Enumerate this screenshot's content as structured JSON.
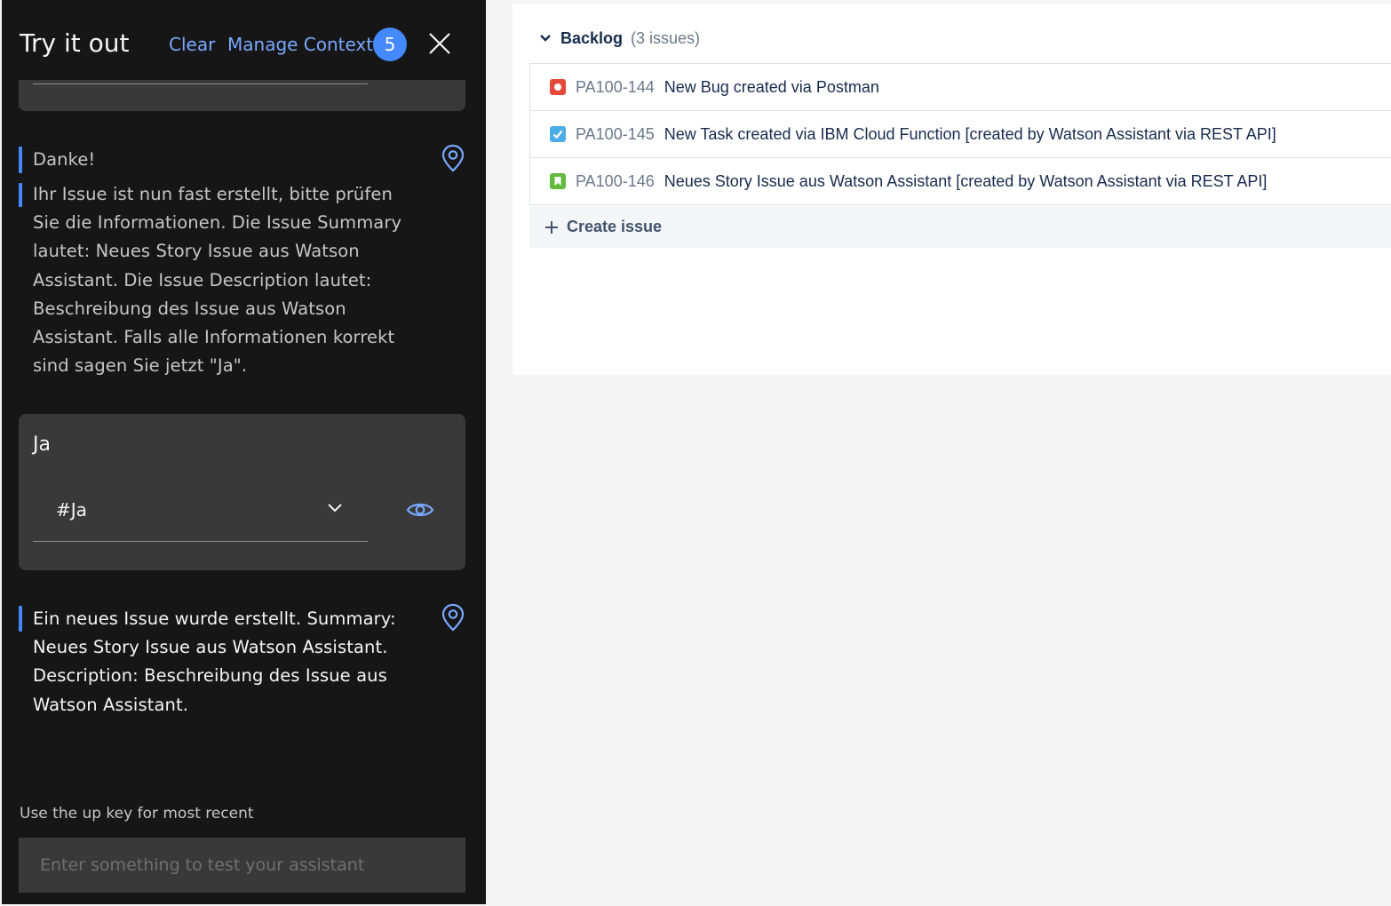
{
  "assistant_panel": {
    "title": "Try it out",
    "clear_label": "Clear",
    "manage_context_label": "Manage Context",
    "context_count": "5",
    "messages": [
      {
        "text": "Danke!"
      },
      {
        "lines": [
          "Ihr Issue ist nun fast erstellt, bitte prüfen",
          "Sie die Informationen. Die Issue Summary",
          "lautet: Neues Story Issue aus Watson",
          "Assistant. Die Issue Description lautet:",
          "Beschreibung des Issue aus Watson",
          "Assistant. Falls alle Informationen korrekt",
          "sind sagen Sie jetzt \"Ja\"."
        ]
      },
      {
        "lines": [
          "Ein neues Issue wurde erstellt. Summary:",
          "Neues Story Issue aus Watson Assistant.",
          "Description: Beschreibung des Issue aus",
          "Watson Assistant."
        ]
      }
    ],
    "user_input": {
      "text": "Ja",
      "intent": "#Ja"
    },
    "hint": "Use the up key for most recent",
    "input_placeholder": "Enter something to test your assistant"
  },
  "backlog": {
    "title": "Backlog",
    "count": "(3 issues)",
    "issues": [
      {
        "key": "PA100-144",
        "summary": "New Bug created via Postman",
        "type": "bug",
        "color": "#e5493a"
      },
      {
        "key": "PA100-145",
        "summary": "New Task created via IBM Cloud Function [created by Watson Assistant via REST API]",
        "type": "task",
        "color": "#4bade8"
      },
      {
        "key": "PA100-146",
        "summary": "Neues Story Issue aus Watson Assistant [created by Watson Assistant via REST API]",
        "type": "story",
        "color": "#63ba3c"
      }
    ],
    "create_label": "Create issue"
  },
  "colors": {
    "panel_bg": "#161616",
    "card_bg": "#393939",
    "accent": "#4589ff",
    "link": "#78a9ff",
    "jira_text": "#172b4d"
  }
}
